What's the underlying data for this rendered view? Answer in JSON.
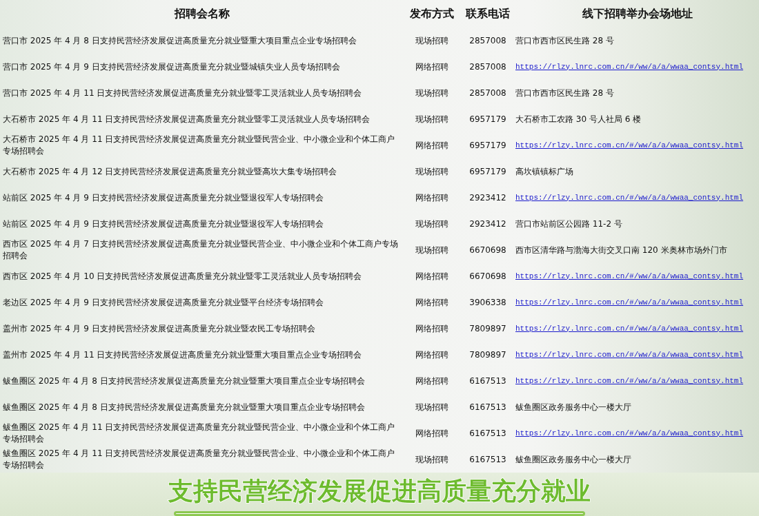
{
  "table": {
    "columns": [
      "招聘会名称",
      "发布方式",
      "联系电话",
      "线下招聘举办会场地址"
    ],
    "rows": [
      {
        "name": "营口市 2025 年 4 月 8 日支持民营经济发展促进高质量充分就业暨重大项目重点企业专场招聘会",
        "method": "现场招聘",
        "phone": "2857008",
        "address": {
          "kind": "text",
          "text": "营口市西市区民生路 28 号"
        }
      },
      {
        "name": "营口市 2025 年 4 月 9 日支持民营经济发展促进高质量充分就业暨城镇失业人员专场招聘会",
        "method": "网络招聘",
        "phone": "2857008",
        "address": {
          "kind": "link",
          "text": "https://rlzy.lnrc.com.cn/#/ww/a/a/wwaa_contsy.html"
        }
      },
      {
        "name": "营口市 2025 年 4 月 11 日支持民营经济发展促进高质量充分就业暨零工灵活就业人员专场招聘会",
        "method": "现场招聘",
        "phone": "2857008",
        "address": {
          "kind": "text",
          "text": "营口市西市区民生路 28 号"
        }
      },
      {
        "name": "大石桥市 2025 年 4 月 11 日支持民营经济发展促进高质量充分就业暨零工灵活就业人员专场招聘会",
        "method": "现场招聘",
        "phone": "6957179",
        "address": {
          "kind": "text",
          "text": "大石桥市工农路 30 号人社局 6 楼"
        }
      },
      {
        "name": "大石桥市 2025 年 4 月 11 日支持民营经济发展促进高质量充分就业暨民营企业、中小微企业和个体工商户专场招聘会",
        "method": "网络招聘",
        "phone": "6957179",
        "address": {
          "kind": "link",
          "text": "https://rlzy.lnrc.com.cn/#/ww/a/a/wwaa_contsy.html"
        }
      },
      {
        "name": "大石桥市 2025 年 4 月 12 日支持民营经济发展促进高质量充分就业暨高坎大集专场招聘会",
        "method": "现场招聘",
        "phone": "6957179",
        "address": {
          "kind": "text",
          "text": "高坎镇镇标广场"
        }
      },
      {
        "name": "站前区 2025 年 4 月 9 日支持民营经济发展促进高质量充分就业暨退役军人专场招聘会",
        "method": "网络招聘",
        "phone": "2923412",
        "address": {
          "kind": "link",
          "text": "https://rlzy.lnrc.com.cn/#/ww/a/a/wwaa_contsy.html"
        }
      },
      {
        "name": "站前区 2025 年 4 月 9 日支持民营经济发展促进高质量充分就业暨退役军人专场招聘会",
        "method": "现场招聘",
        "phone": "2923412",
        "address": {
          "kind": "text",
          "text": "营口市站前区公园路 11-2 号"
        }
      },
      {
        "name": "西市区 2025 年 4 月 7 日支持民营经济发展促进高质量充分就业暨民营企业、中小微企业和个体工商户专场招聘会",
        "method": "现场招聘",
        "phone": "6670698",
        "address": {
          "kind": "text",
          "text": "西市区清华路与渤海大街交叉口南 120 米奥林市场外门市"
        }
      },
      {
        "name": "西市区 2025 年 4 月 10 日支持民营经济发展促进高质量充分就业暨零工灵活就业人员专场招聘会",
        "method": "网络招聘",
        "phone": "6670698",
        "address": {
          "kind": "link",
          "text": "https://rlzy.lnrc.com.cn/#/ww/a/a/wwaa_contsy.html"
        }
      },
      {
        "name": "老边区 2025 年 4 月 9 日支持民营经济发展促进高质量充分就业暨平台经济专场招聘会",
        "method": "网络招聘",
        "phone": "3906338",
        "address": {
          "kind": "link",
          "text": "https://rlzy.lnrc.com.cn/#/ww/a/a/wwaa_contsy.html"
        }
      },
      {
        "name": "盖州市 2025 年 4 月 9 日支持民营经济发展促进高质量充分就业暨农民工专场招聘会",
        "method": "网络招聘",
        "phone": "7809897",
        "address": {
          "kind": "link",
          "text": "https://rlzy.lnrc.com.cn/#/ww/a/a/wwaa_contsy.html"
        }
      },
      {
        "name": "盖州市 2025 年 4 月 11 日支持民营经济发展促进高质量充分就业暨重大项目重点企业专场招聘会",
        "method": "网络招聘",
        "phone": "7809897",
        "address": {
          "kind": "link",
          "text": "https://rlzy.lnrc.com.cn/#/ww/a/a/wwaa_contsy.html"
        }
      },
      {
        "name": "鲅鱼圈区 2025 年 4 月 8 日支持民营经济发展促进高质量充分就业暨重大项目重点企业专场招聘会",
        "method": "网络招聘",
        "phone": "6167513",
        "address": {
          "kind": "link",
          "text": "https://rlzy.lnrc.com.cn/#/ww/a/a/wwaa_contsy.html"
        }
      },
      {
        "name": "鲅鱼圈区 2025 年 4 月 8 日支持民营经济发展促进高质量充分就业暨重大项目重点企业专场招聘会",
        "method": "现场招聘",
        "phone": "6167513",
        "address": {
          "kind": "text",
          "text": "鲅鱼圈区政务服务中心一楼大厅"
        }
      },
      {
        "name": "鲅鱼圈区 2025 年 4 月 11 日支持民营经济发展促进高质量充分就业暨民营企业、中小微企业和个体工商户专场招聘会",
        "method": "网络招聘",
        "phone": "6167513",
        "address": {
          "kind": "link",
          "text": "https://rlzy.lnrc.com.cn/#/ww/a/a/wwaa_contsy.html"
        }
      },
      {
        "name": "鲅鱼圈区 2025 年 4 月 11 日支持民营经济发展促进高质量充分就业暨民营企业、中小微企业和个体工商户专场招聘会",
        "method": "现场招聘",
        "phone": "6167513",
        "address": {
          "kind": "text",
          "text": "鲅鱼圈区政务服务中心一楼大厅"
        }
      }
    ]
  },
  "banner": {
    "title": "支持民营经济发展促进高质量充分就业"
  }
}
